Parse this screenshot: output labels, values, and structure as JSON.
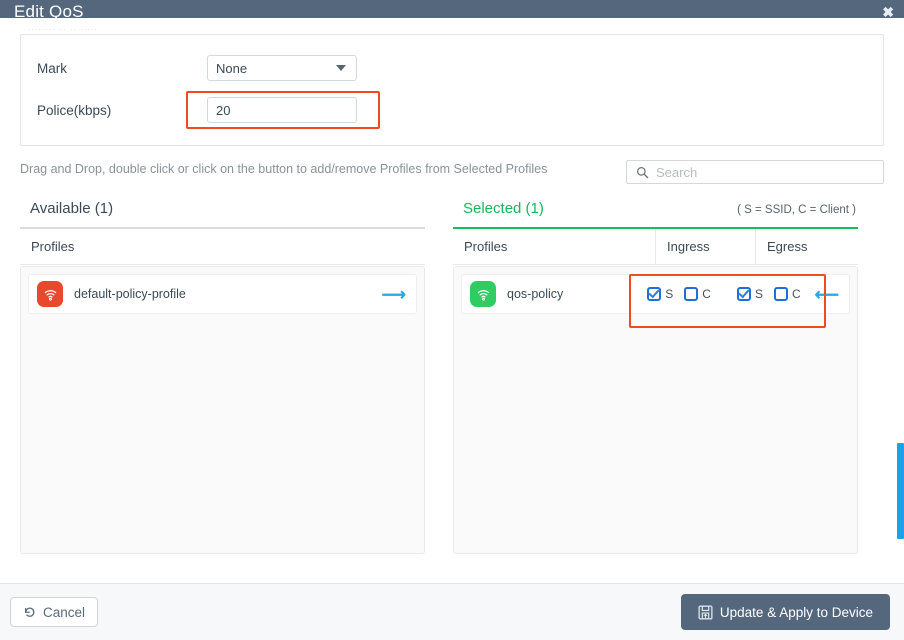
{
  "window": {
    "title": "Edit QoS",
    "close_icon": "close-icon",
    "ghost_label": "........ .. .. ....."
  },
  "form": {
    "mark": {
      "label": "Mark",
      "value": "None",
      "options": [
        "None"
      ]
    },
    "police": {
      "label": "Police(kbps)",
      "value": "20",
      "placeholder": ""
    }
  },
  "hint": {
    "text": "Drag and Drop, double click or click on the button to add/remove Profiles from Selected Profiles"
  },
  "search": {
    "placeholder": "Search",
    "value": "",
    "icon": "search-icon"
  },
  "available": {
    "title": "Available (1)",
    "column_header": "Profiles",
    "rows": [
      {
        "name": "default-policy-profile",
        "icon": "wifi-profile-icon",
        "icon_color": "#e8492c",
        "move_icon": "arrow-right-icon"
      }
    ]
  },
  "selected": {
    "title": "Selected (1)",
    "legend": "( S = SSID, C = Client )",
    "columns": [
      "Profiles",
      "Ingress",
      "Egress"
    ],
    "rows": [
      {
        "name": "qos-policy",
        "icon": "wifi-profile-icon",
        "icon_color": "#2fcc62",
        "move_icon": "arrow-left-icon",
        "ingress": {
          "s_label": "S",
          "s_checked": true,
          "c_label": "C",
          "c_checked": false
        },
        "egress": {
          "s_label": "S",
          "s_checked": true,
          "c_label": "C",
          "c_checked": false
        }
      }
    ]
  },
  "footer": {
    "cancel_label": "Cancel",
    "cancel_icon": "undo-icon",
    "submit_label": "Update & Apply to Device",
    "submit_icon": "save-icon"
  },
  "colors": {
    "titlebar": "#54677c",
    "highlight": "#f04a23",
    "selected_accent": "#18bd5b",
    "checkbox_blue": "#1f6fdb",
    "scrollbar": "#1aa4e2",
    "primary_button": "#54677c"
  }
}
